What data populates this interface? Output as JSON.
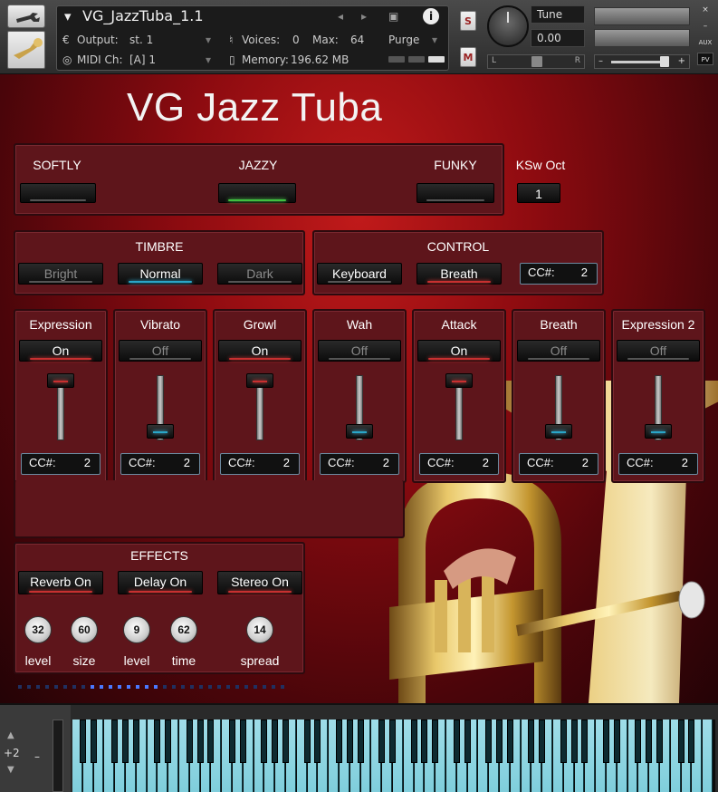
{
  "header": {
    "instrument_name": "VG_JazzTuba_1.1",
    "output_label": "Output:",
    "output_value": "st. 1",
    "voices_label": "Voices:",
    "voices_value": "0",
    "max_label": "Max:",
    "max_value": "64",
    "purge_label": "Purge",
    "midi_label": "MIDI Ch:",
    "midi_value": "[A]  1",
    "memory_label": "Memory:",
    "memory_value": "196.62 MB",
    "solo_label": "S",
    "mute_label": "M",
    "tune_label": "Tune",
    "tune_value": "0.00",
    "pan_left": "L",
    "pan_right": "R",
    "vol_minus": "–",
    "vol_plus": "+",
    "side_close": "×",
    "side_min": "–",
    "aux_label": "AUX",
    "pv_label": "PV"
  },
  "title": "VG Jazz Tuba",
  "styles": {
    "items": [
      {
        "label": "SOFTLY",
        "state": "off"
      },
      {
        "label": "JAZZY",
        "state": "on"
      },
      {
        "label": "FUNKY",
        "state": "off"
      }
    ],
    "ksw_label": "KSw Oct",
    "ksw_value": "1"
  },
  "timbre": {
    "title": "TIMBRE",
    "options": [
      "Bright",
      "Normal",
      "Dark"
    ],
    "selected": "Normal"
  },
  "control": {
    "title": "CONTROL",
    "options": [
      "Keyboard",
      "Breath"
    ],
    "selected": "Breath",
    "cc_label": "CC#:",
    "cc_value": "2"
  },
  "modules": [
    {
      "name": "Expression",
      "state": "On",
      "level": 1.0,
      "cc_label": "CC#:",
      "cc_value": "2"
    },
    {
      "name": "Vibrato",
      "state": "Off",
      "level": 0.0,
      "cc_label": "CC#:",
      "cc_value": "2"
    },
    {
      "name": "Growl",
      "state": "On",
      "level": 1.0,
      "cc_label": "CC#:",
      "cc_value": "2"
    },
    {
      "name": "Wah",
      "state": "Off",
      "level": 0.0,
      "cc_label": "CC#:",
      "cc_value": "2"
    },
    {
      "name": "Attack",
      "state": "On",
      "level": 1.0,
      "cc_label": "CC#:",
      "cc_value": "2"
    },
    {
      "name": "Breath",
      "state": "Off",
      "level": 0.0,
      "cc_label": "CC#:",
      "cc_value": "2"
    },
    {
      "name": "Expression 2",
      "state": "Off",
      "level": 0.0,
      "cc_label": "CC#:",
      "cc_value": "2"
    }
  ],
  "effects": {
    "title": "EFFECTS",
    "buttons": [
      "Reverb On",
      "Delay On",
      "Stereo On"
    ],
    "knobs": [
      {
        "value": "32",
        "label": "level"
      },
      {
        "value": "60",
        "label": "size"
      },
      {
        "value": "9",
        "label": "level"
      },
      {
        "value": "62",
        "label": "time"
      },
      {
        "value": "14",
        "label": "spread"
      }
    ]
  },
  "keyboard": {
    "octave_value": "+2",
    "pitch_label": "–"
  },
  "colors": {
    "accent_on": "#c83030",
    "accent_selected": "#2aa6c8",
    "jazzy_glow": "#40c040",
    "panel": "#5e151b"
  }
}
